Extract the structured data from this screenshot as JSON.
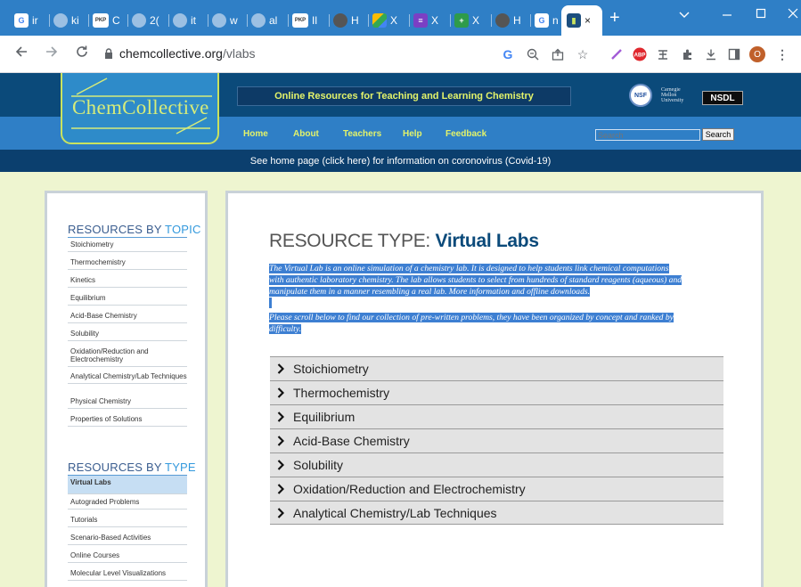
{
  "browser": {
    "tabs": [
      {
        "label": "ir",
        "icon": "google-icon"
      },
      {
        "label": "ki",
        "icon": "globe-icon"
      },
      {
        "label": "C",
        "icon": "pkp-icon"
      },
      {
        "label": "2(",
        "icon": "globe-icon"
      },
      {
        "label": "it",
        "icon": "globe-icon"
      },
      {
        "label": "w",
        "icon": "globe-icon"
      },
      {
        "label": "al",
        "icon": "globe-icon"
      },
      {
        "label": "Il",
        "icon": "pkp-icon"
      },
      {
        "label": "H",
        "icon": "globe-icon"
      },
      {
        "label": "X",
        "icon": "drive-icon"
      },
      {
        "label": "X",
        "icon": "forms-icon"
      },
      {
        "label": "X",
        "icon": "plus-app-icon"
      },
      {
        "label": "H",
        "icon": "globe-icon"
      },
      {
        "label": "n",
        "icon": "google-icon"
      },
      {
        "label": "×",
        "icon": "chemcollective-icon"
      }
    ],
    "pkp_text": "PKP",
    "new_tab": "+",
    "url_domain": "chemcollective.org",
    "url_path": "/vlabs",
    "profile_initial": "O"
  },
  "header": {
    "logo_text": "ChemCollective",
    "tagline": "Online Resources for Teaching and Learning Chemistry",
    "nsf_text": "NSF",
    "cmu_lines": [
      "Carnegie",
      "Mellon",
      "University"
    ],
    "nsdl_text": "NSDL",
    "nav": [
      "Home",
      "About",
      "Teachers",
      "Help",
      "Feedback"
    ],
    "search_placeholder": "Search",
    "search_button": "Search",
    "notice": "See home page (click here) for information on coronovirus (Covid-19)"
  },
  "sidebar": {
    "topic_title_a": "RESOURCES BY ",
    "topic_title_b": "TOPIC",
    "topics": [
      "Stoichiometry",
      "Thermochemistry",
      "Kinetics",
      "Equilibrium",
      "Acid-Base Chemistry",
      "Solubility",
      "Oxidation/Reduction and Electrochemistry",
      "Analytical Chemistry/Lab Techniques",
      "Physical Chemistry",
      "Properties of Solutions"
    ],
    "type_title_a": "RESOURCES BY ",
    "type_title_b": "TYPE",
    "types": [
      "Virtual Labs",
      "Autograded Problems",
      "Tutorials",
      "Scenario-Based Activities",
      "Online Courses",
      "Molecular Level Visualizations"
    ]
  },
  "main": {
    "title_prefix": "RESOURCE TYPE: ",
    "title_bold": "Virtual Labs",
    "intro_lines": [
      "The Virtual Lab is an online simulation of a chemistry lab. It is designed to help students link chemical computations",
      "with authentic laboratory chemistry. The lab allows students to select from hundreds of standard reagents (aqueous) and",
      "manipulate them in a manner resembling a real lab. More information and offline downloads."
    ],
    "note_lines": [
      "Please scroll below to find our collection of pre-written problems, they have been organized by concept and ranked by",
      "difficulty."
    ],
    "sections": [
      "Stoichiometry",
      "Thermochemistry",
      "Equilibrium",
      "Acid-Base Chemistry",
      "Solubility",
      "Oxidation/Reduction and Electrochemistry",
      "Analytical Chemistry/Lab Techniques"
    ]
  },
  "colors": {
    "tabbar": "#2f7fc6",
    "header": "#0b4a7a",
    "accent_yellow": "#e3f36a",
    "page_bg": "#eef5d0",
    "highlight": "#3d7fd2"
  }
}
